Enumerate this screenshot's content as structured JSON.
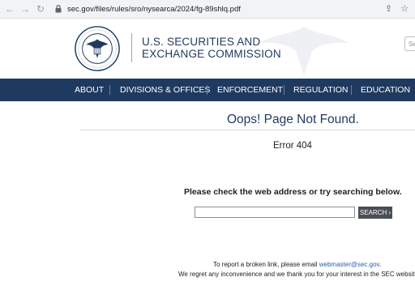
{
  "browser": {
    "url": "sec.gov/files/rules/sro/nysearca/2024/fg-89shlq.pdf",
    "icons": [
      "back-arrow-icon",
      "forward-arrow-icon",
      "reload-icon",
      "lock-icon",
      "share-icon",
      "bookmark-star-icon"
    ]
  },
  "header": {
    "org_line1": "U.S. SECURITIES AND",
    "org_line2": "EXCHANGE COMMISSION",
    "search_stub": "Se"
  },
  "nav": {
    "items": [
      "ABOUT",
      "DIVISIONS & OFFICES",
      "ENFORCEMENT",
      "REGULATION",
      "EDUCATION"
    ]
  },
  "content": {
    "title": "Oops! Page Not Found.",
    "error": "Error 404",
    "instruction": "Please check the web address or try searching below.",
    "search_value": "",
    "search_button": "SEARCH ›"
  },
  "footer": {
    "report_prefix": "To report a broken link, please email ",
    "report_email": "webmaster@sec.gov",
    "report_suffix": ".",
    "apology": "We regret any inconvenience and we thank you for your interest in the SEC website."
  },
  "colors": {
    "navy": "#1f3a5f",
    "link": "#2a5db0",
    "button": "#4a4f55"
  }
}
